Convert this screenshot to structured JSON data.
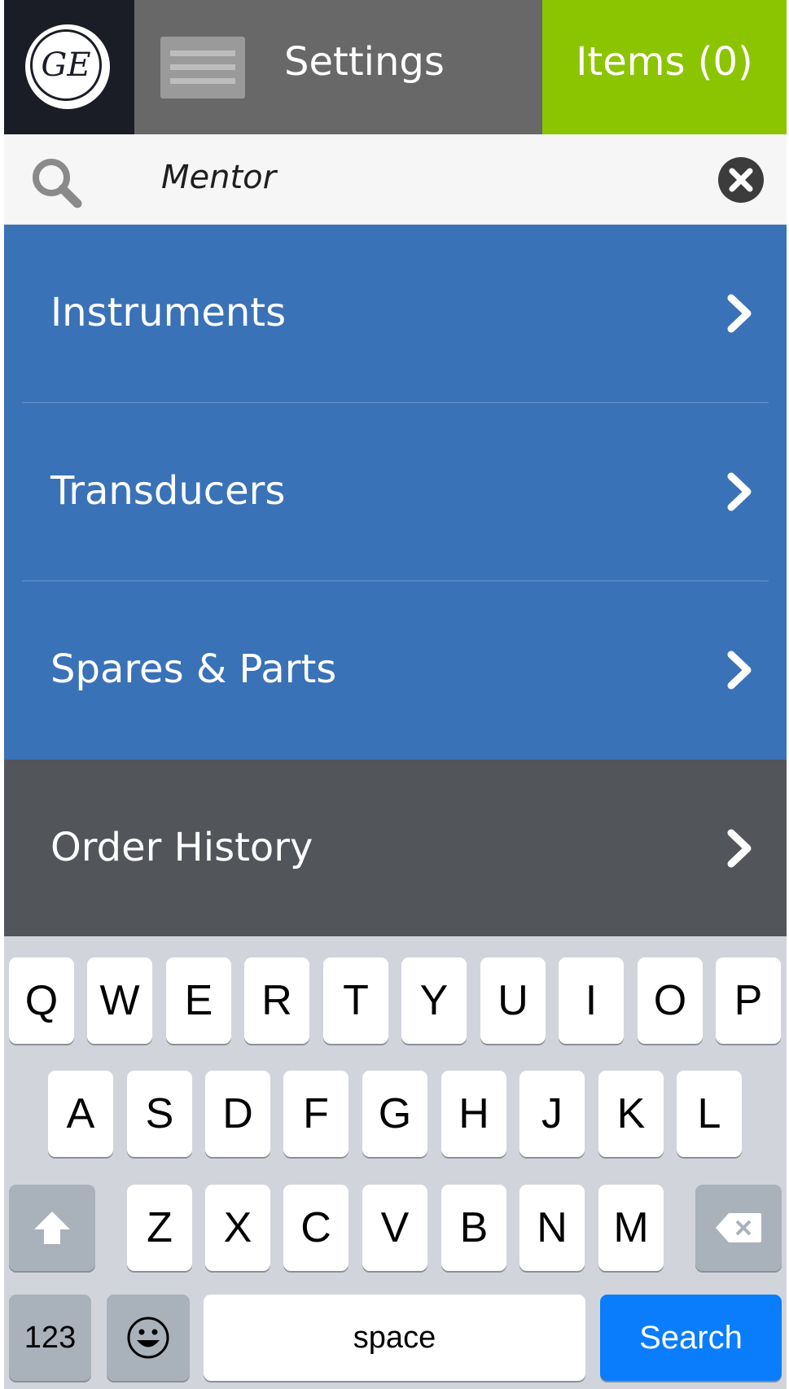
{
  "header": {
    "logo_text": "GE",
    "settings_label": "Settings",
    "items_label": "Items (0)"
  },
  "search": {
    "value": "Mentor"
  },
  "menu": [
    {
      "label": "Instruments",
      "style": "blue"
    },
    {
      "label": "Transducers",
      "style": "blue"
    },
    {
      "label": "Spares & Parts",
      "style": "blue"
    },
    {
      "label": "Order History",
      "style": "dark"
    }
  ],
  "keyboard": {
    "row1": [
      "Q",
      "W",
      "E",
      "R",
      "T",
      "Y",
      "U",
      "I",
      "O",
      "P"
    ],
    "row2": [
      "A",
      "S",
      "D",
      "F",
      "G",
      "H",
      "J",
      "K",
      "L"
    ],
    "row3": [
      "Z",
      "X",
      "C",
      "V",
      "B",
      "N",
      "M"
    ],
    "numbers_label": "123",
    "space_label": "space",
    "search_label": "Search",
    "shift_icon": "shift-icon",
    "backspace_icon": "backspace-icon",
    "emoji_icon": "emoji-icon"
  },
  "colors": {
    "logo_bg": "#1b1d26",
    "settings_bg": "#686868",
    "items_bg": "#8bc400",
    "menu_blue": "#3a72b8",
    "menu_dark": "#52555a",
    "keyboard_bg": "#d1d5db",
    "search_key": "#0a7dfc"
  }
}
